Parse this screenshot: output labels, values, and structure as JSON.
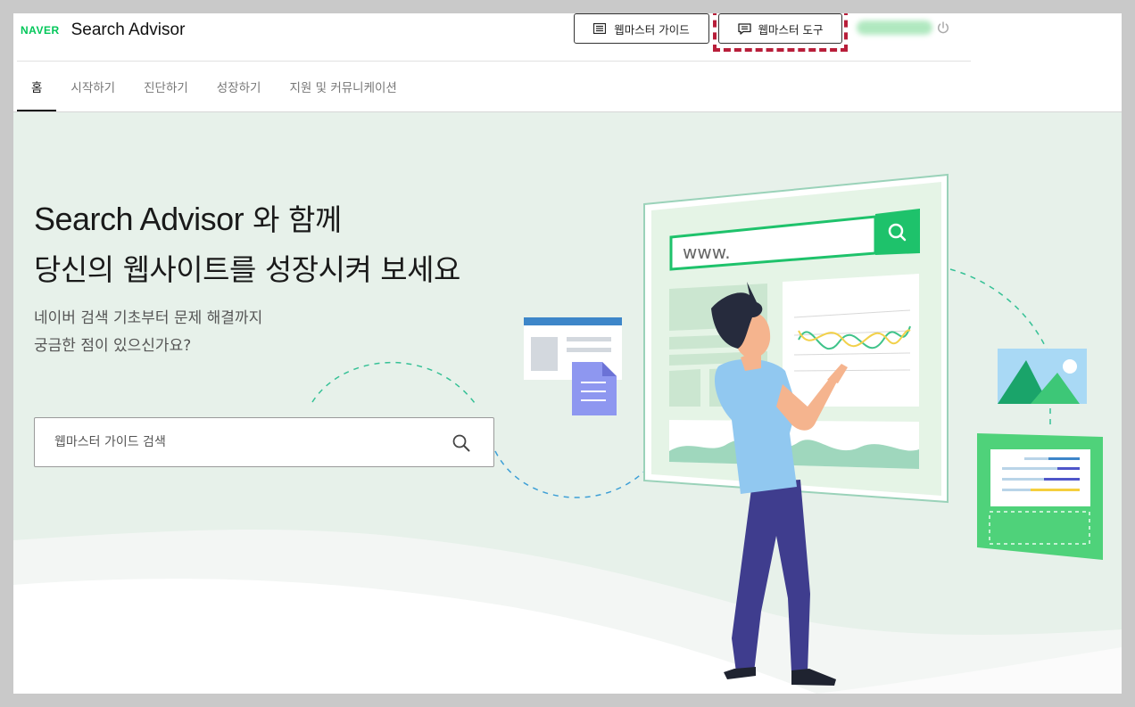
{
  "header": {
    "logo": "NAVER",
    "title": "Search Advisor",
    "guide_button": "웹마스터 가이드",
    "tool_button": "웹마스터 도구",
    "icons": {
      "guide": "list-icon",
      "tool": "chat-icon",
      "logout": "power-icon"
    }
  },
  "nav": {
    "items": [
      {
        "label": "홈",
        "active": true
      },
      {
        "label": "시작하기"
      },
      {
        "label": "진단하기"
      },
      {
        "label": "성장하기"
      },
      {
        "label": "지원 및 커뮤니케이션"
      }
    ]
  },
  "hero": {
    "title_en": "Search Advisor",
    "title_rest": " 와 함께",
    "title_line2": "당신의 웹사이트를 성장시켜 보세요",
    "sub_line1": "네이버 검색 기초부터 문제 해결까지",
    "sub_line2": "궁금한 점이 있으신가요?",
    "search_placeholder": "웹마스터 가이드 검색",
    "illustration_url_text": "www."
  },
  "colors": {
    "brand_green": "#03c75a",
    "hero_bg": "#e7f1ea",
    "highlight_dash": "#b81e3a"
  }
}
